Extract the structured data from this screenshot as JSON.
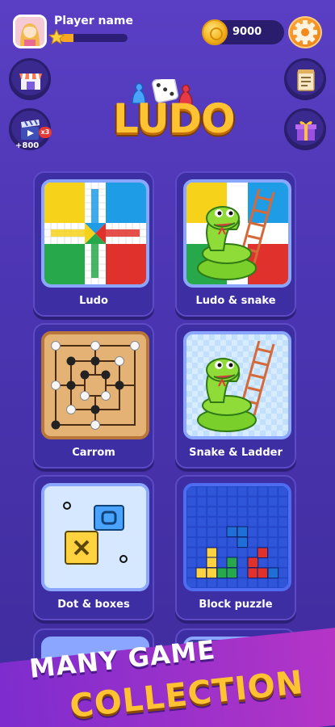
{
  "player": {
    "name": "Player name",
    "xp_progress": 0.2
  },
  "wallet": {
    "coins": "9000"
  },
  "left_actions": {
    "video_bonus": "+800"
  },
  "logo": {
    "text": "LUDO"
  },
  "games": [
    {
      "label": "Ludo",
      "icon": "ludo-board-icon"
    },
    {
      "label": "Ludo & snake",
      "icon": "snake-ladder-icon"
    },
    {
      "label": "Carrom",
      "icon": "carrom-board-icon"
    },
    {
      "label": "Snake & Ladder",
      "icon": "snake-ladder-icon"
    },
    {
      "label": "Dot & boxes",
      "icon": "dots-boxes-icon"
    },
    {
      "label": "Block puzzle",
      "icon": "block-puzzle-icon"
    }
  ],
  "banner": {
    "line1": "MANY GAME",
    "line2": "COLLECTION"
  },
  "colors": {
    "background": "#4c35b2",
    "accent_gold": "#ffc233",
    "card": "#3e2ea3"
  }
}
